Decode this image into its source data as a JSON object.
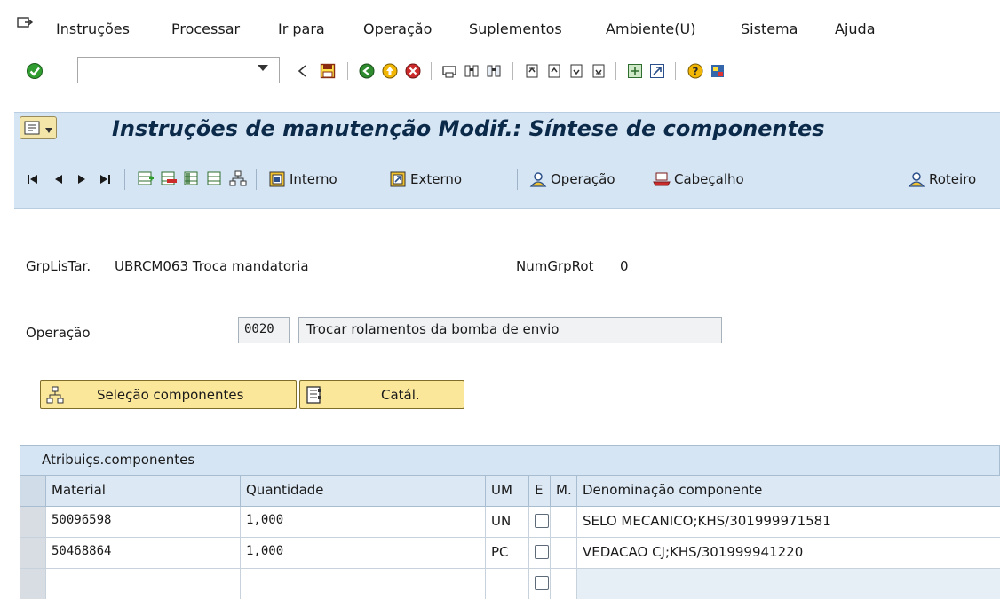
{
  "menubar": {
    "items": [
      {
        "label": "Instruções"
      },
      {
        "label": "Processar"
      },
      {
        "label": "Ir para"
      },
      {
        "label": "Operação"
      },
      {
        "label": "Suplementos"
      },
      {
        "label": "Ambiente(U)"
      },
      {
        "label": "Sistema"
      },
      {
        "label": "Ajuda"
      }
    ]
  },
  "toolbar": {
    "command_field_value": "",
    "icons": [
      "check-icon",
      "back-icon",
      "save-icon",
      "green-back-icon",
      "exit-icon",
      "cancel-icon",
      "print-icon",
      "find-icon",
      "find-next-icon",
      "first-page-icon",
      "previous-page-icon",
      "next-page-icon",
      "last-page-icon",
      "create-session-icon",
      "shortcut-icon",
      "help-icon",
      "customize-layout-icon"
    ]
  },
  "title": {
    "text": "Instruções de manutenção Modif.: Síntese de componentes"
  },
  "app_toolbar": {
    "buttons": [
      {
        "label": "Interno"
      },
      {
        "label": "Externo"
      },
      {
        "label": "Operação"
      },
      {
        "label": "Cabeçalho"
      },
      {
        "label": "Roteiro"
      }
    ]
  },
  "header_info": {
    "group_label": "GrpLisTar.",
    "group_value": "UBRCM063 Troca mandatoria",
    "counter_label": "NumGrpRot",
    "counter_value": "0"
  },
  "operation": {
    "label": "Operação",
    "number": "0020",
    "description": "Trocar rolamentos da bomba de envio"
  },
  "action_buttons": {
    "component_selection": "Seleção componentes",
    "catalog": "Catál."
  },
  "table": {
    "title": "Atribuiçs.componentes",
    "columns": [
      "Material",
      "Quantidade",
      "UM",
      "E",
      "M.",
      "Denominação componente"
    ],
    "rows": [
      {
        "material": "50096598",
        "quantity": "1,000",
        "unit": "UN",
        "description": "SELO MECANICO;KHS/301999971581"
      },
      {
        "material": "50468864",
        "quantity": "1,000",
        "unit": "PC",
        "description": "VEDACAO CJ;KHS/301999941220"
      },
      {
        "material": "",
        "quantity": "",
        "unit": "",
        "description": ""
      }
    ]
  },
  "colors": {
    "band": "#d6e5f4",
    "button_yellow": "#fbe79a",
    "title_text": "#0b2a4a"
  }
}
